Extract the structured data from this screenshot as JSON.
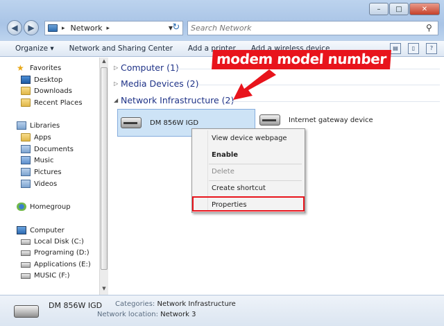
{
  "window": {
    "minimize": "–",
    "maximize": "□",
    "close": "✕"
  },
  "address": {
    "breadcrumb": "Network",
    "refresh_icon": "refresh-icon"
  },
  "search": {
    "placeholder": "Search Network"
  },
  "toolbar": {
    "organize": "Organize ▾",
    "network_sharing_center": "Network and Sharing Center",
    "add_printer": "Add a printer",
    "add_wireless_device": "Add a wireless device"
  },
  "sidebar": {
    "favorites": "Favorites",
    "desktop": "Desktop",
    "downloads": "Downloads",
    "recent_places": "Recent Places",
    "libraries": "Libraries",
    "apps": "Apps",
    "documents": "Documents",
    "music": "Music",
    "pictures": "Pictures",
    "videos": "Videos",
    "homegroup": "Homegroup",
    "computer": "Computer",
    "local_disk": "Local Disk (C:)",
    "programing": "Programing (D:)",
    "applications": "Applications (E:)",
    "music_drive": "MUSIC (F:)"
  },
  "groups": {
    "computer": "Computer (1)",
    "media_devices": "Media Devices (2)",
    "network_infrastructure": "Network Infrastructure (2)"
  },
  "devices": {
    "selected": "DM 856W IGD",
    "gateway": "Internet gateway device"
  },
  "context_menu": {
    "view_webpage": "View device webpage",
    "enable": "Enable",
    "delete": "Delete",
    "create_shortcut": "Create shortcut",
    "properties": "Properties"
  },
  "annotation": {
    "label": "modem model number",
    "color": "#e8141c"
  },
  "details": {
    "name": "DM 856W IGD",
    "categories_label": "Categories:",
    "categories_value": "Network Infrastructure",
    "location_label": "Network location:",
    "location_value": "Network 3"
  }
}
